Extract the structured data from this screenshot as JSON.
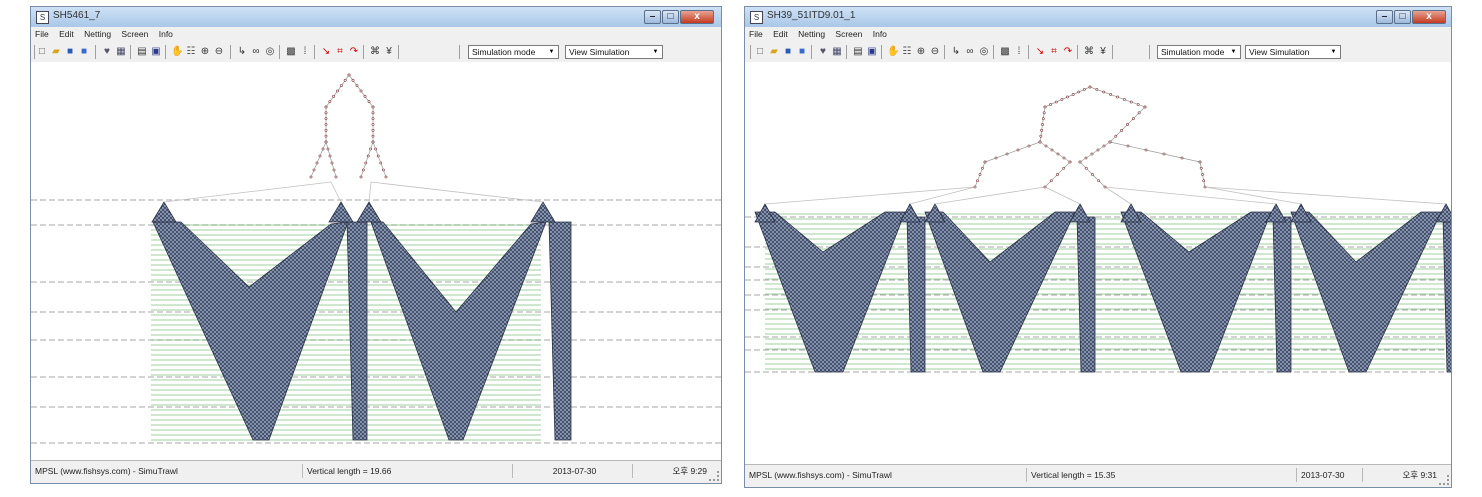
{
  "windows": [
    {
      "title": "SH5461_7",
      "menu": [
        "File",
        "Edit",
        "Netting",
        "Screen",
        "Info"
      ],
      "toolbar": {
        "icons": [
          "new-file-icon",
          "open-folder-icon",
          "save-icon",
          "save-as-icon",
          "calc-icon",
          "grid-icon",
          "print-icon",
          "print-preview-icon",
          "hand-pan-icon",
          "select-icon",
          "zoom-in-icon",
          "zoom-out-icon",
          "axis-icon",
          "link-icon",
          "unlink-icon",
          "mesh-icon",
          "bars-icon",
          "rope-icon",
          "frame-icon",
          "curve-icon",
          "float-icon",
          "sinker-icon"
        ],
        "mode": "Simulation mode",
        "view": "View Simulation"
      },
      "status": {
        "credit": "MPSL (www.fishsys.com) - SimuTrawl",
        "length": "Vertical length = 19.66",
        "date": "2013-07-30",
        "time": "오후 9:29"
      }
    },
    {
      "title": "SH39_51ITD9.01_1",
      "menu": [
        "File",
        "Edit",
        "Netting",
        "Screen",
        "Info"
      ],
      "toolbar": {
        "icons": [
          "new-file-icon",
          "open-folder-icon",
          "save-icon",
          "save-as-icon",
          "calc-icon",
          "grid-icon",
          "print-icon",
          "print-preview-icon",
          "hand-pan-icon",
          "select-icon",
          "zoom-in-icon",
          "zoom-out-icon",
          "axis-icon",
          "link-icon",
          "unlink-icon",
          "mesh-icon",
          "bars-icon",
          "rope-icon",
          "frame-icon",
          "curve-icon",
          "float-icon",
          "sinker-icon"
        ],
        "mode": "Simulation mode",
        "view": "View Simulation"
      },
      "status": {
        "credit": "MPSL (www.fishsys.com) - SimuTrawl",
        "length": "Vertical length = 15.35",
        "date": "2013-07-30",
        "time": "오후 9:31"
      }
    }
  ],
  "colors": {
    "net_fill": "#6d7f9c",
    "net_edge": "#2b3147",
    "waterline": "#3da03d",
    "depth_line": "#8a8a8a",
    "rope": "#c0c0c0",
    "node": "#7a3a3a"
  }
}
